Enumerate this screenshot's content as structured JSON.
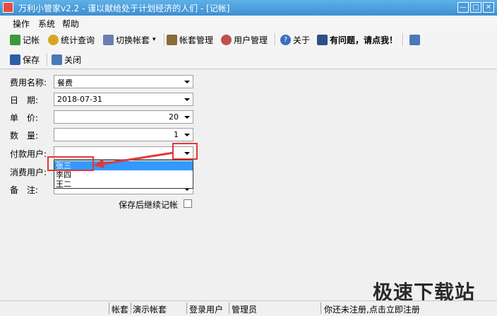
{
  "window": {
    "title": "万利小管家v2.2 - 谨以献给处于计划经济的人们 - [记帐]",
    "min": "—",
    "max": "□",
    "close": "✕"
  },
  "menu": [
    "操作",
    "系统",
    "帮助"
  ],
  "toolbar": {
    "record": "记帐",
    "stats": "统计查询",
    "switch": "切换帐套",
    "account_mgmt": "帐套管理",
    "user_mgmt": "用户管理",
    "about": "关于",
    "help": "有问题，请点我！"
  },
  "toolbar2": {
    "save": "保存",
    "close": "关闭"
  },
  "form": {
    "expense_name_label": "费用名称:",
    "expense_name": "餐费",
    "date_label": "日　期:",
    "date": "2018-07-31",
    "price_label": "单　价:",
    "price": "20",
    "qty_label": "数　量:",
    "qty": "1",
    "payer_label": "付款用户:",
    "consumer_label": "消费用户:",
    "note_label": "备　注:",
    "continue_label": "保存后继续记帐",
    "payer_options": [
      "张三",
      "李四",
      "王二"
    ]
  },
  "status": {
    "account_label": "帐套",
    "account": "演示帐套",
    "user_label": "登录用户",
    "user": "管理员",
    "message": "你还未注册,点击立即注册"
  },
  "watermark": "极速下载站",
  "colors": {
    "selected": "#3399ff",
    "highlight": "#e03a3a"
  }
}
